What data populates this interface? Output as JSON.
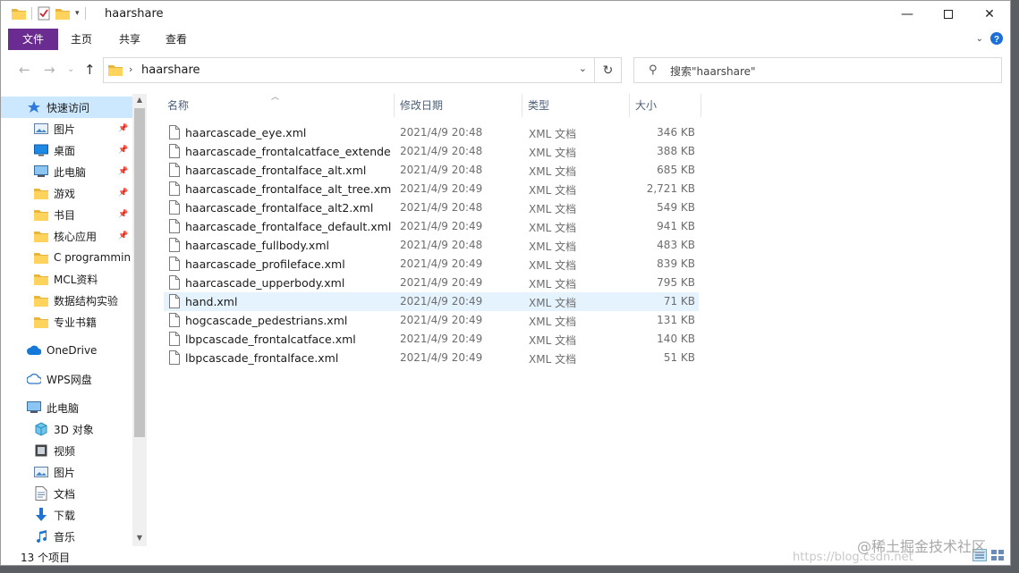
{
  "window": {
    "title": "haarshare"
  },
  "ribbon": {
    "tabs": [
      "文件",
      "主页",
      "共享",
      "查看"
    ]
  },
  "address": {
    "path": "haarshare"
  },
  "search": {
    "placeholder": "搜索\"haarshare\""
  },
  "columns": {
    "name": "名称",
    "date": "修改日期",
    "type": "类型",
    "size": "大小"
  },
  "sidebar": {
    "items": [
      {
        "label": "快速访问",
        "icon": "star-icon",
        "pinned": false
      },
      {
        "label": "图片",
        "icon": "pictures-icon",
        "pinned": true
      },
      {
        "label": "桌面",
        "icon": "desktop-icon",
        "pinned": true
      },
      {
        "label": "此电脑",
        "icon": "computer-icon",
        "pinned": true
      },
      {
        "label": "游戏",
        "icon": "folder-icon",
        "pinned": true
      },
      {
        "label": "书目",
        "icon": "folder-icon",
        "pinned": true
      },
      {
        "label": "核心应用",
        "icon": "folder-icon",
        "pinned": true
      },
      {
        "label": "C programmin",
        "icon": "folder-icon",
        "pinned": false
      },
      {
        "label": "MCL资料",
        "icon": "folder-icon",
        "pinned": false
      },
      {
        "label": "数据结构实验",
        "icon": "folder-icon",
        "pinned": false
      },
      {
        "label": "专业书籍",
        "icon": "folder-icon",
        "pinned": false
      },
      {
        "label": "OneDrive",
        "icon": "cloud-icon",
        "pinned": false
      },
      {
        "label": "WPS网盘",
        "icon": "cloud-outline-icon",
        "pinned": false
      },
      {
        "label": "此电脑",
        "icon": "computer-icon",
        "pinned": false
      },
      {
        "label": "3D 对象",
        "icon": "cube-icon",
        "pinned": false
      },
      {
        "label": "视频",
        "icon": "video-icon",
        "pinned": false
      },
      {
        "label": "图片",
        "icon": "pictures-icon",
        "pinned": false
      },
      {
        "label": "文档",
        "icon": "document-icon",
        "pinned": false
      },
      {
        "label": "下载",
        "icon": "download-icon",
        "pinned": false
      },
      {
        "label": "音乐",
        "icon": "music-icon",
        "pinned": false
      }
    ]
  },
  "files": [
    {
      "name": "haarcascade_eye.xml",
      "date": "2021/4/9 20:48",
      "type": "XML 文档",
      "size": "346 KB"
    },
    {
      "name": "haarcascade_frontalcatface_extended...",
      "date": "2021/4/9 20:48",
      "type": "XML 文档",
      "size": "388 KB"
    },
    {
      "name": "haarcascade_frontalface_alt.xml",
      "date": "2021/4/9 20:48",
      "type": "XML 文档",
      "size": "685 KB"
    },
    {
      "name": "haarcascade_frontalface_alt_tree.xml",
      "date": "2021/4/9 20:49",
      "type": "XML 文档",
      "size": "2,721 KB"
    },
    {
      "name": "haarcascade_frontalface_alt2.xml",
      "date": "2021/4/9 20:48",
      "type": "XML 文档",
      "size": "549 KB"
    },
    {
      "name": "haarcascade_frontalface_default.xml",
      "date": "2021/4/9 20:49",
      "type": "XML 文档",
      "size": "941 KB"
    },
    {
      "name": "haarcascade_fullbody.xml",
      "date": "2021/4/9 20:48",
      "type": "XML 文档",
      "size": "483 KB"
    },
    {
      "name": "haarcascade_profileface.xml",
      "date": "2021/4/9 20:49",
      "type": "XML 文档",
      "size": "839 KB"
    },
    {
      "name": "haarcascade_upperbody.xml",
      "date": "2021/4/9 20:49",
      "type": "XML 文档",
      "size": "795 KB"
    },
    {
      "name": "hand.xml",
      "date": "2021/4/9 20:49",
      "type": "XML 文档",
      "size": "71 KB"
    },
    {
      "name": "hogcascade_pedestrians.xml",
      "date": "2021/4/9 20:49",
      "type": "XML 文档",
      "size": "131 KB"
    },
    {
      "name": "lbpcascade_frontalcatface.xml",
      "date": "2021/4/9 20:49",
      "type": "XML 文档",
      "size": "140 KB"
    },
    {
      "name": "lbpcascade_frontalface.xml",
      "date": "2021/4/9 20:49",
      "type": "XML 文档",
      "size": "51 KB"
    }
  ],
  "status": {
    "count": "13 个项目"
  },
  "watermark": {
    "text": "@稀土掘金技术社区",
    "url_partial": "https://blog.csdn.net"
  },
  "colors": {
    "file_tab": "#6b2c91",
    "selected": "#cce8ff",
    "hover": "#e5f3ff",
    "header_text": "#4c607a"
  }
}
